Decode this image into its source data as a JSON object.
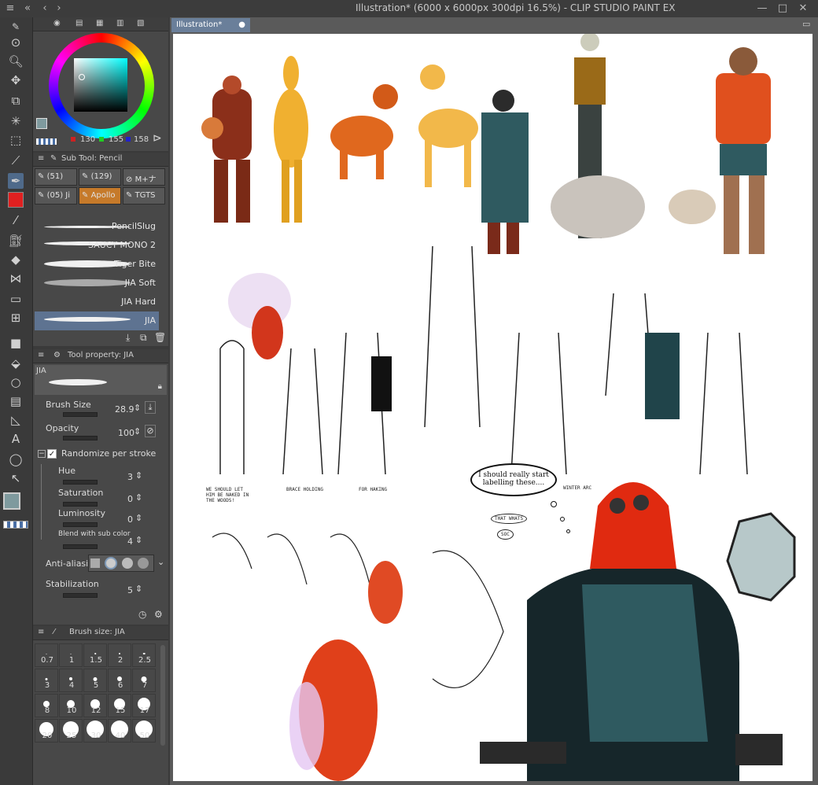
{
  "window": {
    "title": "Illustration* (6000 x 6000px 300dpi 16.5%)  - CLIP STUDIO PAINT EX"
  },
  "canvas_tab": {
    "label": "Illustration*"
  },
  "color_panel": {
    "r": "130",
    "g": "155",
    "b": "158",
    "main_color": "#7f9a9e"
  },
  "subtool_panel": {
    "header": "Sub Tool: Pencil",
    "tabs": [
      {
        "label": "(51)"
      },
      {
        "label": "(129)"
      },
      {
        "label": "M+ナ"
      },
      {
        "label": "(05) Ji"
      },
      {
        "label": "Apollo"
      },
      {
        "label": "TGTS"
      }
    ],
    "brushes": [
      {
        "label": "PencilSlug"
      },
      {
        "label": "SAUCY MONO 2"
      },
      {
        "label": "Tiger Bite"
      },
      {
        "label": "JIA Soft"
      },
      {
        "label": "JIA Hard"
      },
      {
        "label": "JIA"
      }
    ]
  },
  "tool_property": {
    "header": "Tool property: JIA",
    "preview_label": "JIA",
    "brush_size": {
      "label": "Brush Size",
      "value": "28.9"
    },
    "opacity": {
      "label": "Opacity",
      "value": "100"
    },
    "randomize": {
      "label": "Randomize per stroke",
      "checked": true
    },
    "hue": {
      "label": "Hue",
      "value": "3"
    },
    "saturation": {
      "label": "Saturation",
      "value": "0"
    },
    "luminosity": {
      "label": "Luminosity",
      "value": "0"
    },
    "blend": {
      "label": "Blend with sub color",
      "value": "4"
    },
    "anti_aliasing": {
      "label": "Anti-aliasing"
    },
    "stabilization": {
      "label": "Stabilization",
      "value": "5"
    }
  },
  "brush_size_panel": {
    "header": "Brush size: JIA",
    "sizes": [
      "0.7",
      "1",
      "1.5",
      "2",
      "2.5",
      "3",
      "4",
      "5",
      "6",
      "7",
      "8",
      "10",
      "12",
      "15",
      "17",
      "20",
      "25",
      "30",
      "40",
      "50"
    ]
  },
  "canvas_text": {
    "bubble": "I should really start labelling these....",
    "note1": "WE SHOULD LET HIM BE NAKED IN THE WOODS!",
    "note2": "BRACE HOLDING",
    "note3": "FOR HAKING",
    "note4": "WINTER ARC",
    "note5": "THAT WHATS",
    "note6": "SOC"
  }
}
